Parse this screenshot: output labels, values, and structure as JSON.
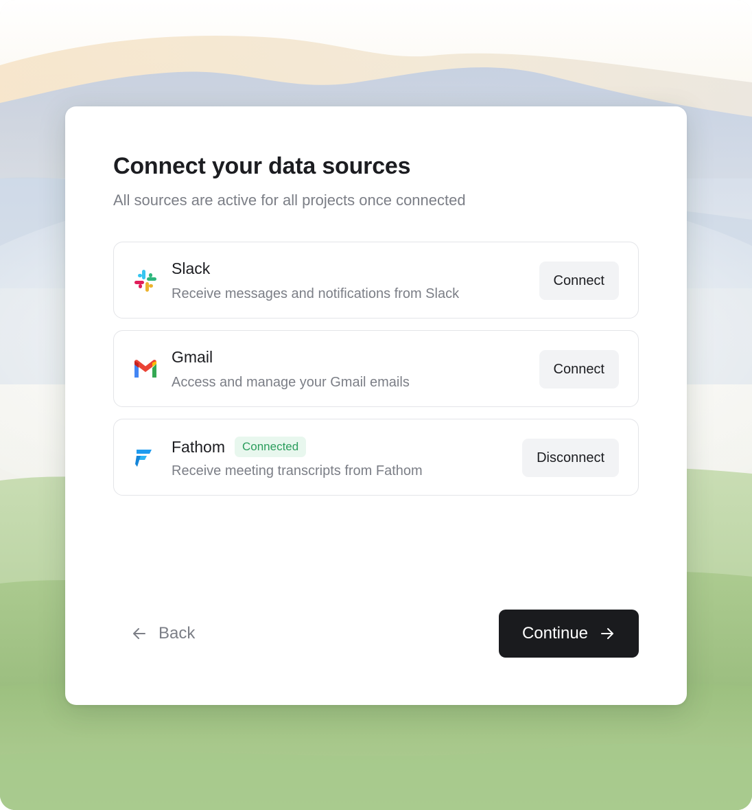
{
  "dialog": {
    "title": "Connect your data sources",
    "subtitle": "All sources are active for all projects once connected"
  },
  "sources": [
    {
      "name": "Slack",
      "description": "Receive messages and notifications from Slack",
      "action_label": "Connect",
      "icon": "slack-logo-icon"
    },
    {
      "name": "Gmail",
      "description": "Access and manage your Gmail emails",
      "action_label": "Connect",
      "icon": "gmail-logo-icon"
    },
    {
      "name": "Fathom",
      "description": "Receive meeting transcripts from Fathom",
      "status_badge": "Connected",
      "action_label": "Disconnect",
      "icon": "fathom-logo-icon"
    }
  ],
  "footer": {
    "back_label": "Back",
    "back_icon": "arrow-left-icon",
    "continue_label": "Continue",
    "continue_icon": "arrow-right-icon"
  },
  "colors": {
    "primary_button": "#1a1b1e",
    "connected_badge_bg": "#e8f7ee",
    "connected_badge_text": "#2a9d5c",
    "secondary_button_bg": "#f2f3f5"
  }
}
